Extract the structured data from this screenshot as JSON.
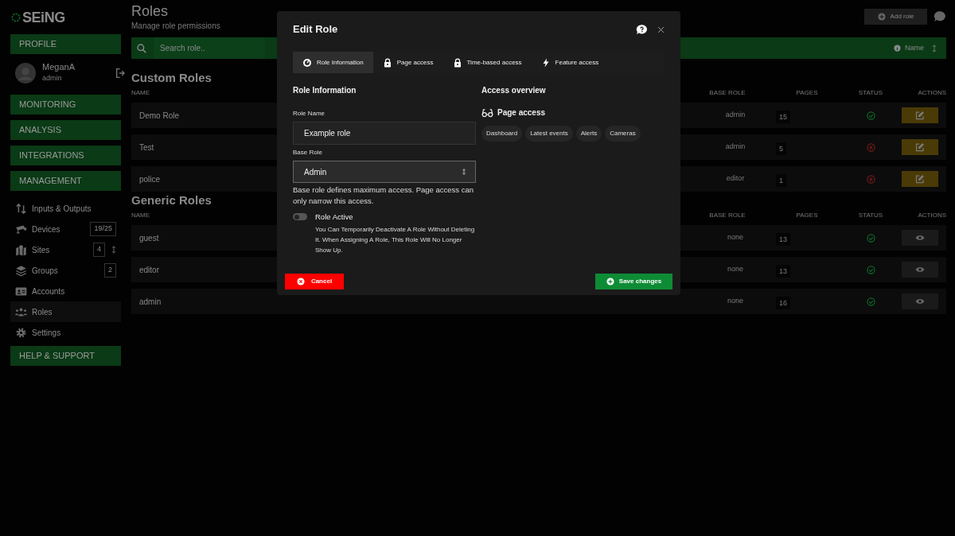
{
  "brand": "SEiNG",
  "page": {
    "title": "Roles",
    "subtitle": "Manage role permissions",
    "add_button": "Add role",
    "search_placeholder": "Search role..",
    "sort_label": "Name"
  },
  "sidebar": [
    {
      "kind": "section",
      "label": "PROFILE"
    },
    {
      "kind": "user",
      "name": "MeganA",
      "role": "admin"
    },
    {
      "kind": "section",
      "label": "MONITORING"
    },
    {
      "kind": "section",
      "label": "ANALYSIS"
    },
    {
      "kind": "section",
      "label": "INTEGRATIONS"
    },
    {
      "kind": "section",
      "label": "MANAGEMENT"
    },
    {
      "kind": "item",
      "label": "Inputs & Outputs",
      "selected": false
    },
    {
      "kind": "item",
      "label": "Devices",
      "badge": "19/25",
      "selected": false
    },
    {
      "kind": "item",
      "label": "Sites",
      "badge": "4",
      "expandable": true,
      "selected": false
    },
    {
      "kind": "item",
      "label": "Groups",
      "badge": "2",
      "selected": false
    },
    {
      "kind": "item",
      "label": "Accounts",
      "selected": false
    },
    {
      "kind": "item",
      "label": "Roles",
      "selected": true
    },
    {
      "kind": "item",
      "label": "Settings",
      "selected": false
    },
    {
      "kind": "section",
      "label": "HELP & SUPPORT"
    }
  ],
  "tables": [
    {
      "title": "Custom Roles",
      "columns": [
        "NAME",
        "BASE ROLE",
        "PAGES",
        "STATUS",
        "ACTIONS"
      ],
      "rows": [
        {
          "kind": "editable",
          "name": "Demo Role",
          "base_role": "admin",
          "pages": "15",
          "active": true
        },
        {
          "kind": "editable",
          "name": "Test",
          "base_role": "admin",
          "pages": "5",
          "active": false
        },
        {
          "kind": "editable",
          "name": "police",
          "base_role": "editor",
          "pages": "1",
          "active": false
        }
      ]
    },
    {
      "title": "Generic Roles",
      "columns": [
        "NAME",
        "BASE ROLE",
        "PAGES",
        "STATUS",
        "ACTIONS"
      ],
      "rows": [
        {
          "kind": "viewable",
          "name": "guest",
          "base_role": "none",
          "pages": "13",
          "active": true
        },
        {
          "kind": "viewable",
          "name": "editor",
          "base_role": "none",
          "pages": "13",
          "active": true
        },
        {
          "kind": "viewable",
          "name": "admin",
          "base_role": "none",
          "pages": "16",
          "active": true
        }
      ]
    }
  ],
  "dialog": {
    "title": "Edit Role",
    "tabs": [
      {
        "label": "Role Information",
        "selected": true
      },
      {
        "label": "Page access",
        "selected": false
      },
      {
        "label": "Time-based access",
        "selected": false
      },
      {
        "label": "Feature access",
        "selected": false
      }
    ],
    "section_title": "Role Information",
    "role_name_label": "Role Name",
    "role_name_value": "Example role",
    "base_role_label": "Base Role",
    "base_role_value": "Admin",
    "base_role_hint": "Base role defines maximum access. Page access can only narrow this access.",
    "active_label": "Role Active",
    "active_on": false,
    "active_hint": "You Can Temporarily Deactivate A Role Without Deleting It. When Assigning A Role, This Role Will No Longer Show Up.",
    "overview_title": "Access overview",
    "page_access_title": "Page access",
    "pages": [
      "Dashboard",
      "Latest events",
      "Alerts",
      "Cameras"
    ],
    "cancel": "Cancel",
    "save": "Save changes"
  }
}
